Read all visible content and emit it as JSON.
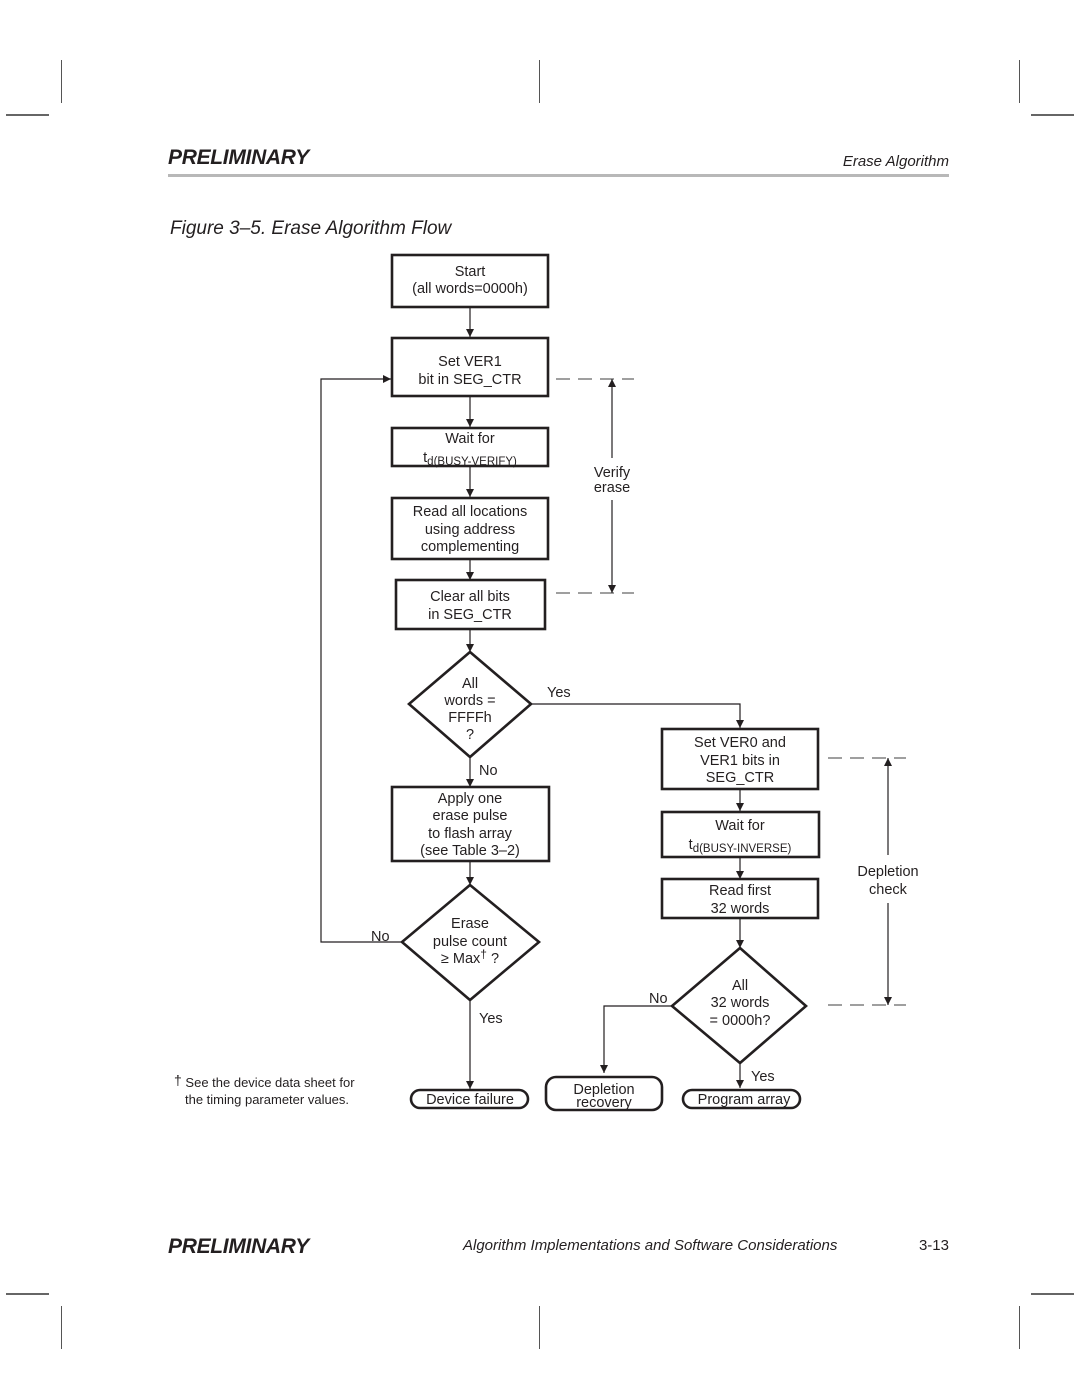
{
  "header": {
    "left": "PRELIMINARY",
    "right": "Erase Algorithm"
  },
  "figure": {
    "title": "Figure 3–5.  Erase Algorithm Flow",
    "nodes": {
      "start": [
        "Start",
        "(all words=0000h)"
      ],
      "set_ver1": [
        "Set VER1",
        "bit in SEG_CTR"
      ],
      "wait_verify": {
        "line1": "Wait for",
        "t": "t",
        "sub": "d(BUSY-VERIFY)"
      },
      "read_all": [
        "Read all locations",
        "using address",
        "complementing"
      ],
      "clear_bits": [
        "Clear all bits",
        "in SEG_CTR"
      ],
      "decision_ffff": [
        "All",
        "words =",
        "FFFFh",
        "?"
      ],
      "apply_pulse": [
        "Apply one",
        "erase pulse",
        "to flash array",
        "(see Table 3–2)"
      ],
      "decision_max": {
        "line1": "Erase",
        "line2": "pulse count",
        "line3": "≥ Max",
        "dagger": "†",
        "q": " ?"
      },
      "device_failure": "Device failure",
      "set_ver0": [
        "Set VER0 and",
        "VER1 bits in",
        "SEG_CTR"
      ],
      "wait_inverse": {
        "line1": "Wait for",
        "t": "t",
        "sub": "d(BUSY-INVERSE)"
      },
      "read_first": [
        "Read first",
        "32 words"
      ],
      "decision_0000": [
        "All",
        "32 words",
        "= 0000h?"
      ],
      "depletion_recovery": [
        "Depletion",
        "recovery"
      ],
      "program_array": "Program array"
    },
    "labels": {
      "yes": "Yes",
      "no": "No",
      "verify_erase": [
        "Verify",
        "erase"
      ],
      "depletion_check": [
        "Depletion",
        "check"
      ]
    },
    "footnote": {
      "dagger": "†",
      "line1": "See the device data sheet for",
      "line2": "the timing parameter values."
    }
  },
  "footer": {
    "left": "PRELIMINARY",
    "center": "Algorithm Implementations and Software Considerations",
    "page": "3-13"
  }
}
